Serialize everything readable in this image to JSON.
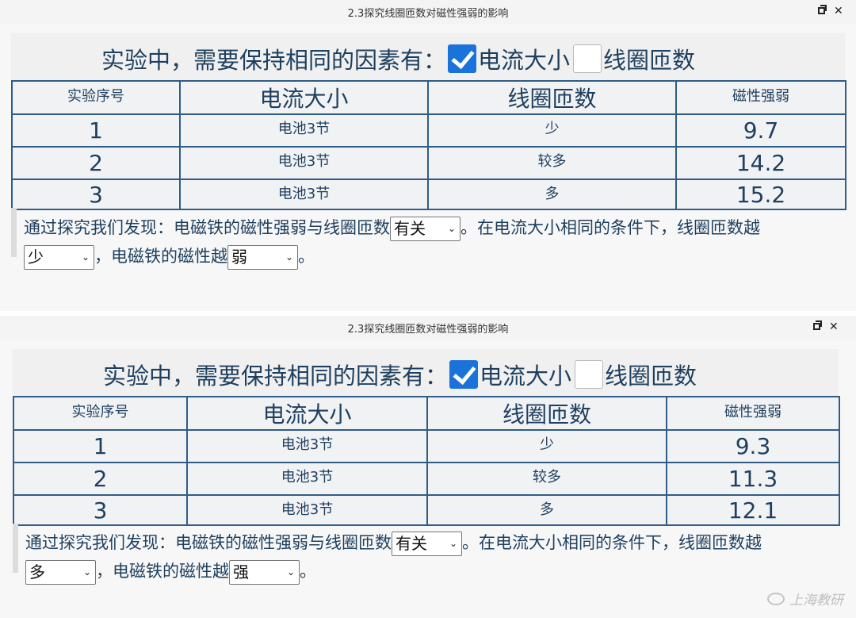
{
  "windows": [
    {
      "title": "2.3探究线圈匝数对磁性强弱的影响",
      "heading": {
        "prefix": "实验中，需要保持相同的因素有：",
        "option1": {
          "label": "电流大小",
          "checked": true
        },
        "option2": {
          "label": "线圈匝数",
          "checked": false
        }
      },
      "table": {
        "headers": [
          "实验序号",
          "电流大小",
          "线圈匝数",
          "磁性强弱"
        ],
        "rows": [
          {
            "no": "1",
            "current": "电池3节",
            "turns": "少",
            "strength": "9.7"
          },
          {
            "no": "2",
            "current": "电池3节",
            "turns": "较多",
            "strength": "14.2"
          },
          {
            "no": "3",
            "current": "电池3节",
            "turns": "多",
            "strength": "15.2"
          }
        ]
      },
      "conclusion": {
        "part1": "通过探究我们发现：电磁铁的磁性强弱与线圈匝数",
        "select1": "有关",
        "part2": "。在电流大小相同的条件下，线圈匝数越",
        "select2": "少",
        "part3": "，电磁铁的磁性越",
        "select3": "弱",
        "part4": "。"
      }
    },
    {
      "title": "2.3探究线圈匝数对磁性强弱的影响",
      "heading": {
        "prefix": "实验中，需要保持相同的因素有：",
        "option1": {
          "label": "电流大小",
          "checked": true
        },
        "option2": {
          "label": "线圈匝数",
          "checked": false
        }
      },
      "table": {
        "headers": [
          "实验序号",
          "电流大小",
          "线圈匝数",
          "磁性强弱"
        ],
        "rows": [
          {
            "no": "1",
            "current": "电池3节",
            "turns": "少",
            "strength": "9.3"
          },
          {
            "no": "2",
            "current": "电池3节",
            "turns": "较多",
            "strength": "11.3"
          },
          {
            "no": "3",
            "current": "电池3节",
            "turns": "多",
            "strength": "12.1"
          }
        ]
      },
      "conclusion": {
        "part1": "通过探究我们发现：电磁铁的磁性强弱与线圈匝数",
        "select1": "有关",
        "part2": "。在电流大小相同的条件下，线圈匝数越",
        "select2": "多",
        "part3": "，电磁铁的磁性越",
        "select3": "强",
        "part4": "。"
      }
    }
  ],
  "icons": {
    "restore": "restore-icon",
    "close": "close-icon",
    "caret": "chevron-down-icon",
    "watermark": "wechat-icon"
  },
  "glyphs": {
    "close": "✕",
    "caret": "⌄"
  },
  "watermark": "上海教研",
  "colors": {
    "text": "#1e3f5e",
    "border": "#2f5d87",
    "checkbox": "#1a73d9"
  }
}
